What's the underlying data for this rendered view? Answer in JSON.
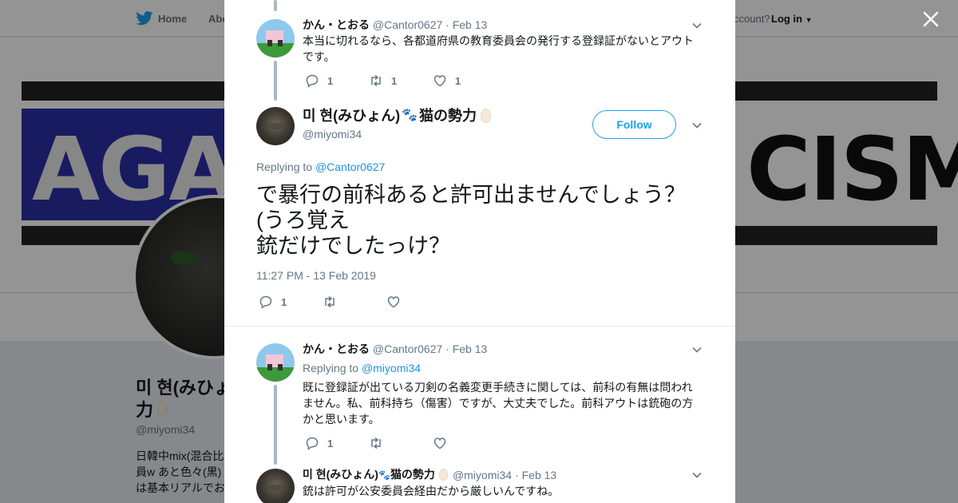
{
  "background": {
    "nav": {
      "home": "Home",
      "about": "Abo",
      "account_prompt": "ccount?",
      "login": "Log in"
    },
    "banner": {
      "left_word": "AGA",
      "right_word": "CISM"
    },
    "profile": {
      "name_line1": "미 현(みひょ",
      "name_line2": "力",
      "handle": "@miyomi34",
      "bio": [
        "日韓中mix(混合比",
        "員w あと色々(黒)",
        "は基本リアルでお"
      ]
    }
  },
  "modal": {
    "tweets": [
      {
        "name": "かん・とおる",
        "handle": "@Cantor0627",
        "date": "· Feb 13",
        "text": "本当に切れるなら、各都道府県の教育委員会の発行する登録証がないとアウトです。",
        "counts": {
          "reply": "1",
          "retweet": "1",
          "like": "1"
        }
      },
      {
        "name": "かん・とおる",
        "handle": "@Cantor0627",
        "date": "· Feb 13",
        "replying_prefix": "Replying to",
        "replying_to": "@miyomi34",
        "text": "既に登録証が出ている刀剣の名義変更手続きに関しては、前科の有無は問われません。私、前科持ち（傷害）ですが、大丈夫でした。前科アウトは銃砲の方かと思います。",
        "counts": {
          "reply": "1",
          "retweet": "",
          "like": ""
        }
      },
      {
        "name_prefix": "미 현(みひょん)",
        "name_suffix": "猫の勢力",
        "handle": "@miyomi34",
        "date": "· Feb 13",
        "text": "銃は許可が公安委員会経由だから厳しいんですね。"
      }
    ],
    "main": {
      "name_prefix": "미 현(みひょん)",
      "name_suffix": "猫の勢力",
      "handle": "@miyomi34",
      "follow": "Follow",
      "replying_prefix": "Replying to",
      "replying_to": "@Cantor0627",
      "text_lines": [
        "で暴行の前科あると許可出ませんでしょう？",
        "(うろ覚え",
        "銃だけでしたっけ？"
      ],
      "timestamp": "11:27 PM - 13 Feb 2019",
      "counts": {
        "reply": "1",
        "retweet": "",
        "like": ""
      }
    }
  },
  "colors": {
    "accent": "#1da1f2",
    "link": "#1b95e0",
    "muted": "#657786",
    "thread": "#aab8c2"
  }
}
